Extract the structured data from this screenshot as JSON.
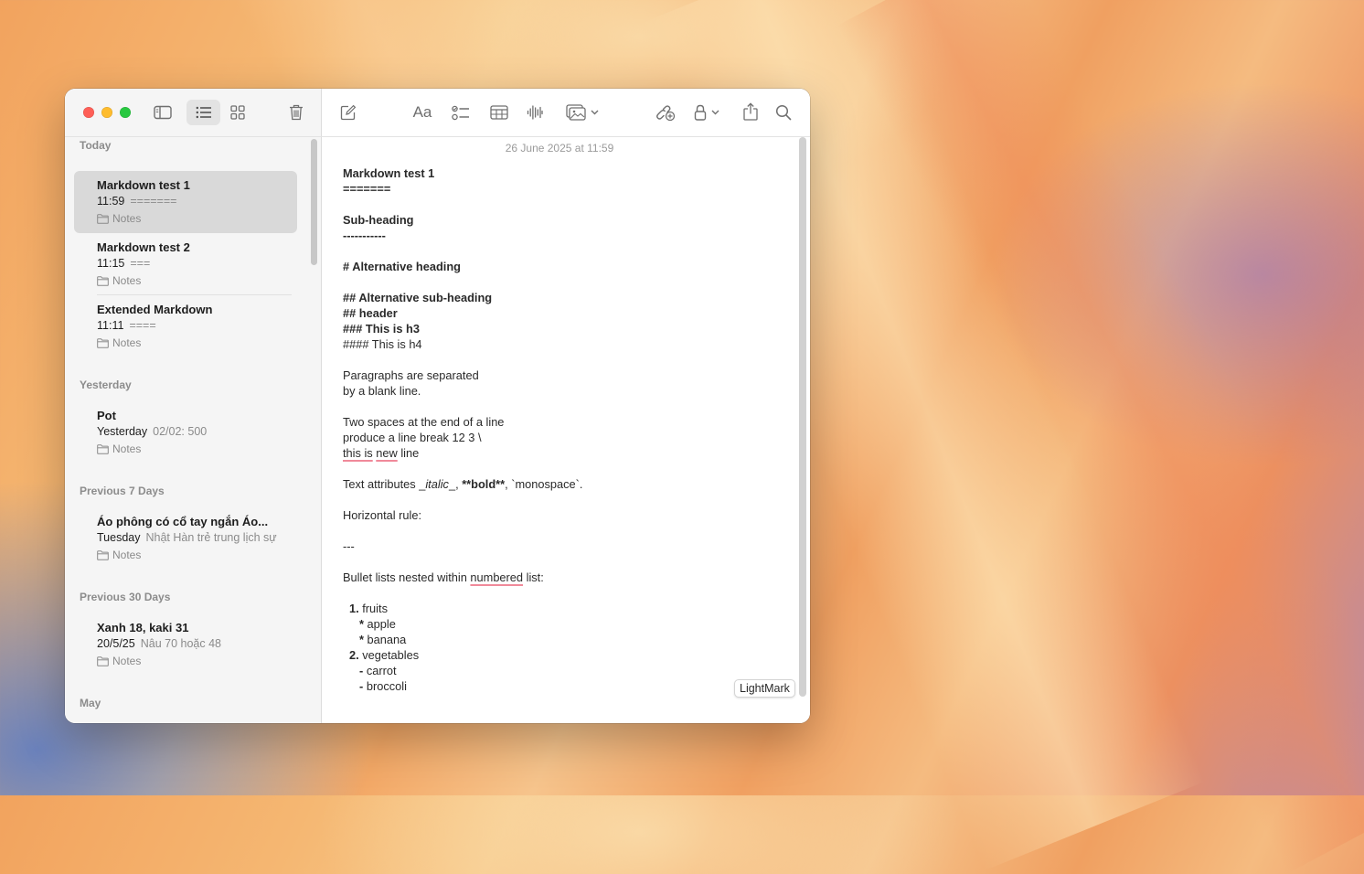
{
  "window": {
    "toolbar": {
      "format_label": "Aa"
    }
  },
  "sidebar": {
    "sections": [
      {
        "label": "Today",
        "notes": [
          {
            "title": "Markdown test 1",
            "time": "11:59",
            "preview": "=======",
            "folder": "Notes",
            "selected": true
          },
          {
            "title": "Markdown test 2",
            "time": "11:15",
            "preview": "===",
            "folder": "Notes"
          },
          {
            "title": "Extended Markdown",
            "time": "11:11",
            "preview": "====",
            "folder": "Notes"
          }
        ]
      },
      {
        "label": "Yesterday",
        "notes": [
          {
            "title": "Pot",
            "time": "Yesterday",
            "preview": "02/02: 500",
            "folder": "Notes"
          }
        ]
      },
      {
        "label": "Previous 7 Days",
        "notes": [
          {
            "title": "Áo phông có cổ tay ngắn Áo...",
            "time": "Tuesday",
            "preview": "Nhật Hàn trẻ trung lịch sự",
            "folder": "Notes"
          }
        ]
      },
      {
        "label": "Previous 30 Days",
        "notes": [
          {
            "title": "Xanh 18, kaki 31",
            "time": "20/5/25",
            "preview": "Nâu 70 hoặc 48",
            "folder": "Notes"
          }
        ]
      },
      {
        "label": "May",
        "notes": []
      }
    ]
  },
  "editor": {
    "date": "26 June 2025 at 11:59",
    "lines": {
      "l1": "Markdown test 1",
      "l2": "=======",
      "l3": "Sub-heading",
      "l4": "-----------",
      "l5": "# Alternative heading",
      "l6": "## Alternative sub-heading",
      "l7": "## header",
      "l8": "### This is h3",
      "l9": "#### This is h4",
      "l10": "Paragraphs are separated",
      "l11": "by a blank line.",
      "l12": "Two spaces at the end of a line",
      "l13": "produce a line break 12 3 \\",
      "l14a": "this is",
      "l14b": "new",
      "l14c": "line",
      "l15a": "Text attributes _",
      "l15b": "italic",
      "l15c": "_, ",
      "l15d": "**bold**",
      "l15e": ", `monospace`.",
      "l16": "Horizontal rule:",
      "l17": "---",
      "l18a": "Bullet lists nested within ",
      "l18b": "numbered",
      "l18c": " list:",
      "l19a": "1.",
      "l19b": " fruits",
      "l20a": "*",
      "l20b": " apple",
      "l21a": "*",
      "l21b": " banana",
      "l22a": "2.",
      "l22b": " vegetables",
      "l23a": "-",
      "l23b": " carrot",
      "l24a": "-",
      "l24b": " broccoli"
    },
    "badge": "LightMark"
  }
}
